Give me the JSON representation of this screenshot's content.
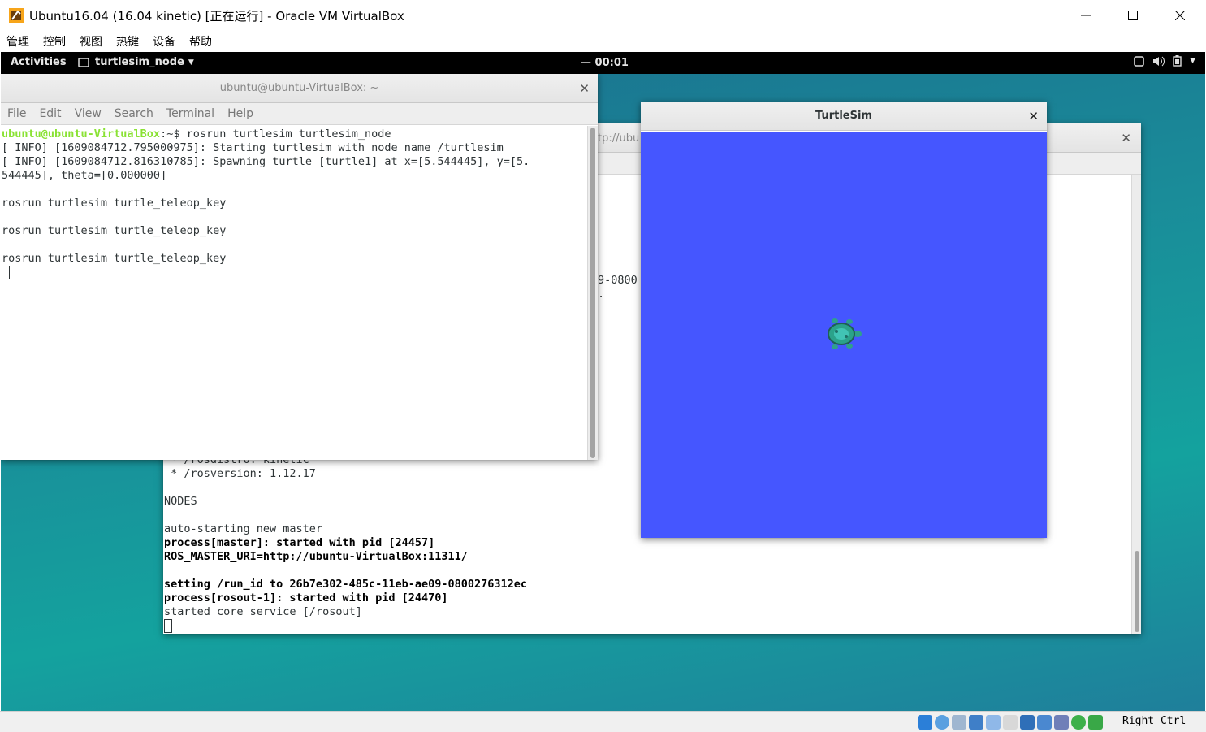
{
  "host": {
    "title": "Ubuntu16.04 (16.04 kinetic) [正在运行] - Oracle VM VirtualBox",
    "menu": [
      "管理",
      "控制",
      "视图",
      "热键",
      "设备",
      "帮助"
    ],
    "host_key": "Right Ctrl"
  },
  "topbar": {
    "activities": "Activities",
    "app_name": "turtlesim_node",
    "clock": "00:01"
  },
  "term1": {
    "title": "ubuntu@ubuntu-VirtualBox: ~",
    "menu": [
      "File",
      "Edit",
      "View",
      "Search",
      "Terminal",
      "Help"
    ],
    "prompt_user": "ubuntu@ubuntu-VirtualBox",
    "prompt_rest": ":~$ rosrun turtlesim turtlesim_node",
    "lines": [
      "[ INFO] [1609084712.795000975]: Starting turtlesim with node name /turtlesim",
      "[ INFO] [1609084712.816310785]: Spawning turtle [turtle1] at x=[5.544445], y=[5.",
      "544445], theta=[0.000000]",
      "",
      "rosrun turtlesim turtle_teleop_key",
      "",
      "rosrun turtlesim turtle_teleop_key",
      "",
      "rosrun turtlesim turtle_teleop_key"
    ]
  },
  "term2": {
    "title_fragment": "tp://ubu",
    "frag_lines": [
      "9-0800",
      "."
    ],
    "lines_normal_top": [
      " * /rosdistro: kinetic",
      " * /rosversion: 1.12.17",
      "",
      "NODES",
      "",
      "auto-starting new master"
    ],
    "lines_bold": [
      "process[master]: started with pid [24457]",
      "ROS_MASTER_URI=http://ubuntu-VirtualBox:11311/",
      "",
      "setting /run_id to 26b7e302-485c-11eb-ae09-0800276312ec",
      "process[rosout-1]: started with pid [24470]"
    ],
    "last_line": "started core service [/rosout]"
  },
  "turtlesim": {
    "title": "TurtleSim",
    "bg_color": "#4556ff"
  }
}
